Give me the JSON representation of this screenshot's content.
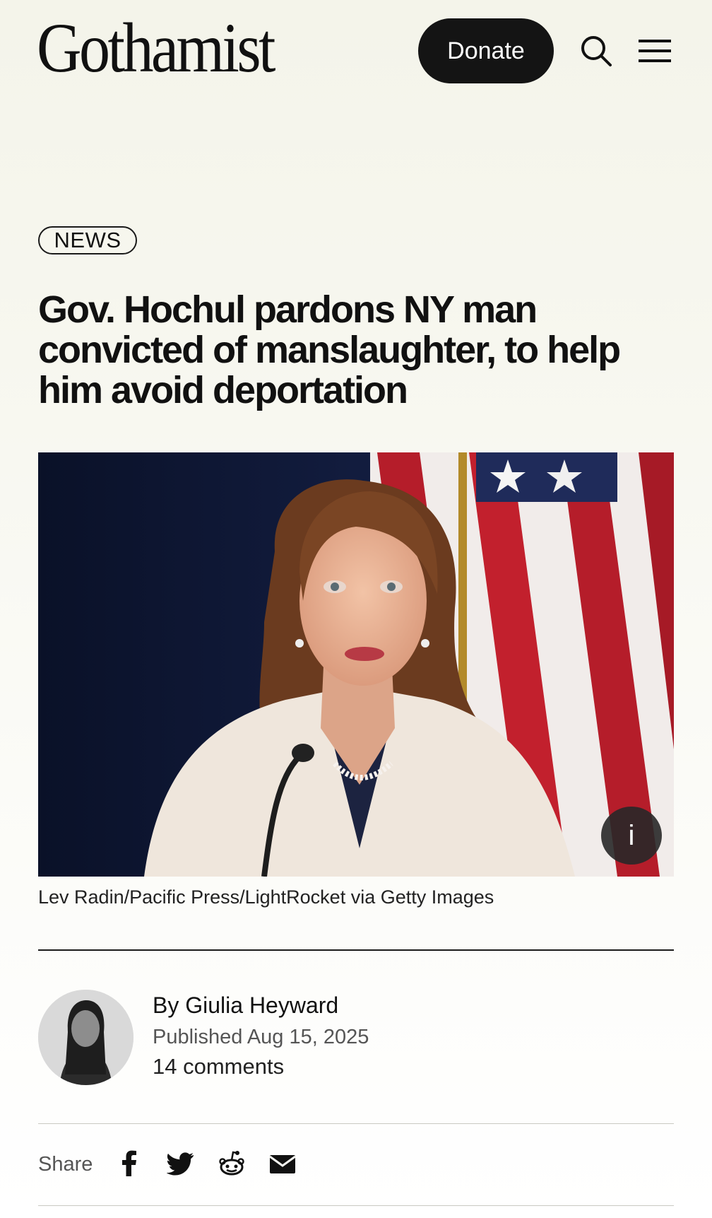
{
  "header": {
    "logo": "Gothamist",
    "donate_label": "Donate",
    "search_icon": "search-icon",
    "menu_icon": "hamburger-menu-icon"
  },
  "article": {
    "tag": "NEWS",
    "headline": "Gov. Hochul pardons NY man convicted of manslaughter, to help him avoid deportation",
    "image_info_label": "i",
    "photo_credit": "Lev Radin/Pacific Press/LightRocket via Getty Images",
    "byline": "By Giulia Heyward",
    "published": "Published Aug 15, 2025",
    "comments": "14 comments"
  },
  "share": {
    "label": "Share",
    "icons": [
      "facebook-icon",
      "twitter-icon",
      "reddit-icon",
      "email-icon"
    ]
  },
  "colors": {
    "background": "#f4f4ea",
    "text": "#111111",
    "button": "#141414"
  }
}
